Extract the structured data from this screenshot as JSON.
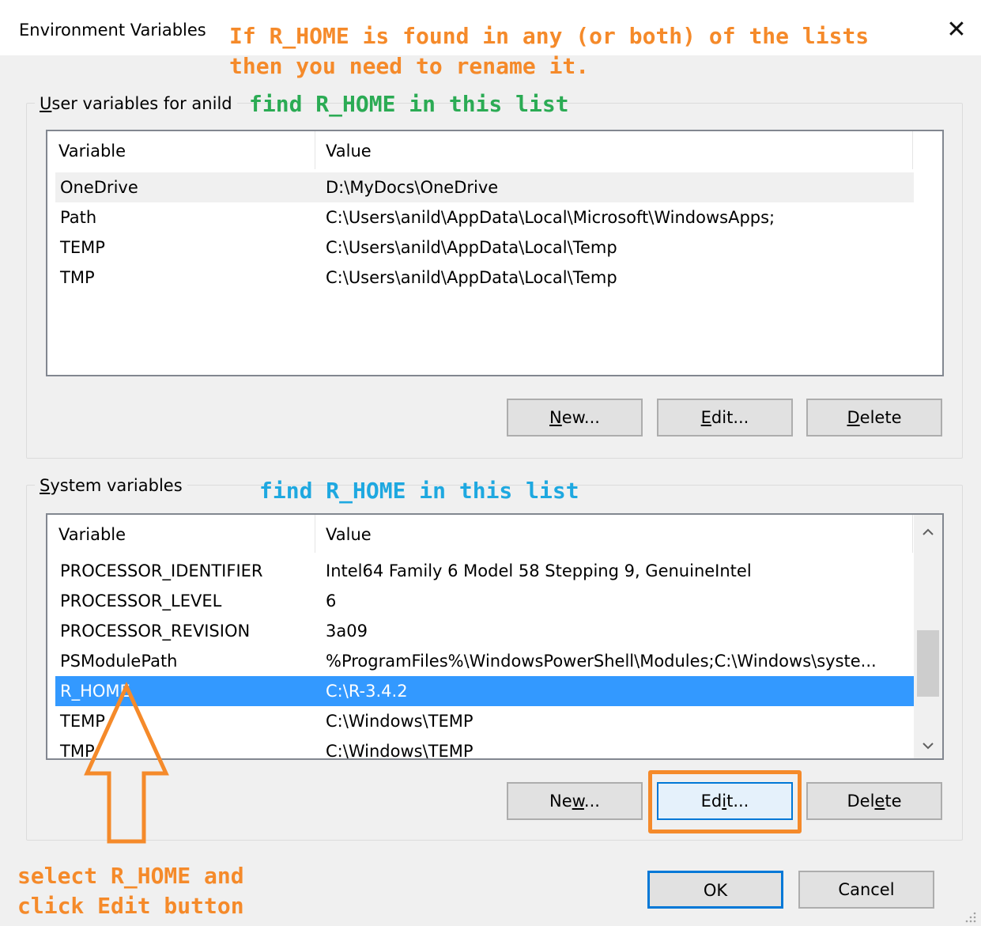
{
  "window": {
    "title": "Environment Variables",
    "close_symbol": "✕"
  },
  "annotations": {
    "top_line1": "If R_HOME is found in any (or both) of the lists",
    "top_line2": "then you need to rename it.",
    "user_note": "find R_HOME in this list",
    "system_note": "find R_HOME in this list",
    "bottom_line1": "select R_HOME and",
    "bottom_line2": "click Edit button",
    "annotation_color": "#f58a2a",
    "user_note_color": "#2bab54",
    "system_note_color": "#1ea8e0"
  },
  "user_vars": {
    "label_prefix": "U",
    "label_rest": "ser variables for anild",
    "columns": [
      "Variable",
      "Value"
    ],
    "rows": [
      {
        "variable": "OneDrive",
        "value": "D:\\MyDocs\\OneDrive"
      },
      {
        "variable": "Path",
        "value": "C:\\Users\\anild\\AppData\\Local\\Microsoft\\WindowsApps;"
      },
      {
        "variable": "TEMP",
        "value": "C:\\Users\\anild\\AppData\\Local\\Temp"
      },
      {
        "variable": "TMP",
        "value": "C:\\Users\\anild\\AppData\\Local\\Temp"
      }
    ],
    "buttons": {
      "new_u": "N",
      "new_rest": "ew...",
      "edit_u": "E",
      "edit_rest": "dit...",
      "delete_u": "D",
      "delete_rest": "elete"
    }
  },
  "system_vars": {
    "label_prefix": "S",
    "label_rest": "ystem variables",
    "columns": [
      "Variable",
      "Value"
    ],
    "rows": [
      {
        "variable": "PROCESSOR_IDENTIFIER",
        "value": "Intel64 Family 6 Model 58 Stepping 9, GenuineIntel"
      },
      {
        "variable": "PROCESSOR_LEVEL",
        "value": "6"
      },
      {
        "variable": "PROCESSOR_REVISION",
        "value": "3a09"
      },
      {
        "variable": "PSModulePath",
        "value": "%ProgramFiles%\\WindowsPowerShell\\Modules;C:\\Windows\\syste..."
      },
      {
        "variable": "R_HOME",
        "value": "C:\\R-3.4.2"
      },
      {
        "variable": "TEMP",
        "value": "C:\\Windows\\TEMP"
      },
      {
        "variable": "TMP",
        "value": "C:\\Windows\\TEMP"
      }
    ],
    "selected_row": "R_HOME",
    "buttons": {
      "new_a": "Ne",
      "new_u": "w",
      "new_b": "...",
      "edit_a": "Ed",
      "edit_u": "i",
      "edit_b": "t...",
      "delete_a": "Del",
      "delete_u": "e",
      "delete_b": "te"
    }
  },
  "dialog_buttons": {
    "ok": "OK",
    "cancel": "Cancel"
  },
  "colors": {
    "selection": "#3399ff",
    "focus_border": "#0078d7"
  }
}
